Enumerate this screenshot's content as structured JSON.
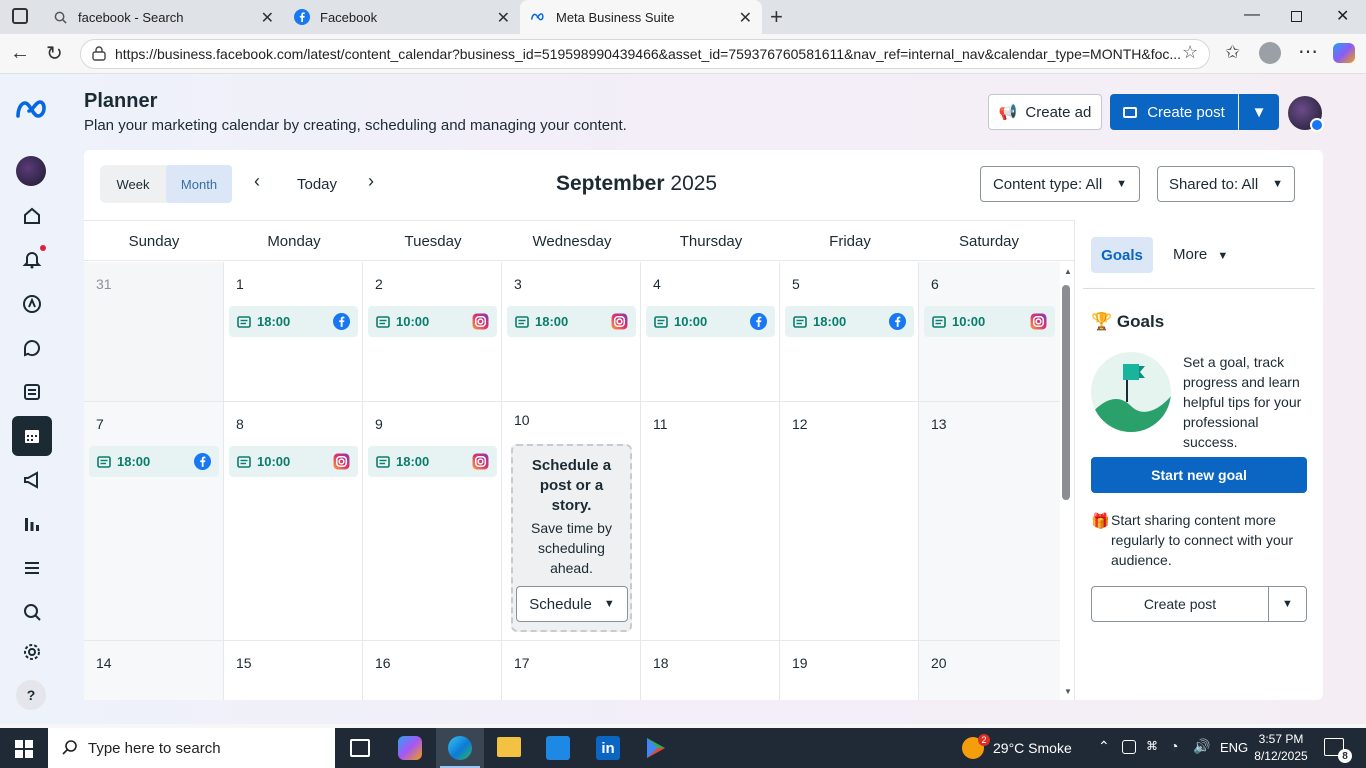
{
  "browser": {
    "tabs": [
      {
        "title": "facebook - Search"
      },
      {
        "title": "Facebook"
      },
      {
        "title": "Meta Business Suite"
      }
    ],
    "url": "https://business.facebook.com/latest/content_calendar?business_id=519598990439466&asset_id=759376760581611&nav_ref=internal_nav&calendar_type=MONTH&foc..."
  },
  "header": {
    "title": "Planner",
    "subtitle": "Plan your marketing calendar by creating, scheduling and managing your content.",
    "create_ad": "Create ad",
    "create_post": "Create post"
  },
  "calendar": {
    "view_week": "Week",
    "view_month": "Month",
    "today": "Today",
    "month": "September",
    "year": "2025",
    "content_type": "Content type: All",
    "shared_to": "Shared to: All",
    "days": [
      "Sunday",
      "Monday",
      "Tuesday",
      "Wednesday",
      "Thursday",
      "Friday",
      "Saturday"
    ],
    "week1": [
      "31",
      "1",
      "2",
      "3",
      "4",
      "5",
      "6"
    ],
    "week2": [
      "7",
      "8",
      "9",
      "10",
      "11",
      "12",
      "13"
    ],
    "week3": [
      "14",
      "15",
      "16",
      "17",
      "18",
      "19",
      "20"
    ],
    "events_week1": [
      {
        "time": "18:00",
        "platform": "facebook"
      },
      {
        "time": "10:00",
        "platform": "instagram"
      },
      {
        "time": "18:00",
        "platform": "instagram"
      },
      {
        "time": "10:00",
        "platform": "facebook"
      },
      {
        "time": "18:00",
        "platform": "facebook"
      },
      {
        "time": "10:00",
        "platform": "instagram"
      }
    ],
    "events_week2": [
      {
        "time": "18:00",
        "platform": "facebook"
      },
      {
        "time": "10:00",
        "platform": "instagram"
      },
      {
        "time": "18:00",
        "platform": "instagram"
      }
    ],
    "schedule_card": {
      "title": "Schedule a post or a story.",
      "body": "Save time by scheduling ahead.",
      "button": "Schedule"
    }
  },
  "side": {
    "tab_goals": "Goals",
    "tab_more": "More",
    "goals_title": "Goals",
    "goals_text": "Set a goal, track progress and learn helpful tips for your professional success.",
    "start_goal": "Start new goal",
    "share_text": "Start sharing content more regularly to connect with your audience.",
    "create_post": "Create post"
  },
  "taskbar": {
    "search_placeholder": "Type here to search",
    "weather": "29°C Smoke",
    "weather_badge": "2",
    "lang": "ENG",
    "time": "3:57 PM",
    "date": "8/12/2025",
    "notif_count": "8"
  },
  "colors": {
    "accent": "#1877f2",
    "primary_button": "#0a66c2",
    "event_bg": "#e7f3f3",
    "event_text": "#0a7c6d"
  }
}
